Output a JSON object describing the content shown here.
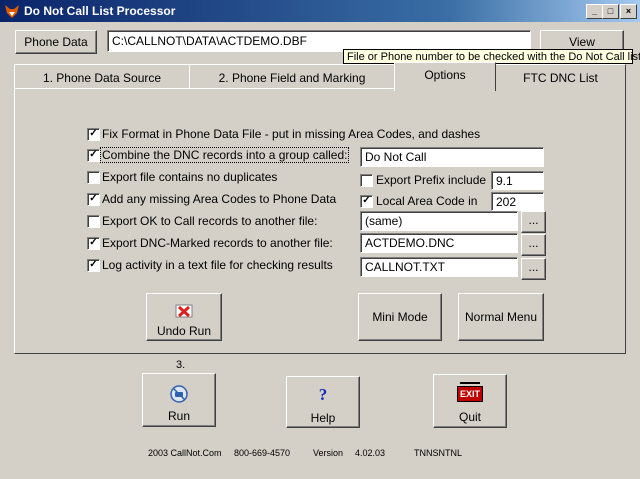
{
  "window": {
    "title": "Do Not Call List Processor",
    "controls": {
      "minimize": "_",
      "maximize": "□",
      "close": "×"
    }
  },
  "toolbar": {
    "phone_data_button": "Phone Data",
    "path_value": "C:\\CALLNOT\\DATA\\ACTDEMO.DBF",
    "view_button": "View",
    "tooltip": "File or Phone number to be checked with the Do Not Call list"
  },
  "tabs": [
    {
      "label": "1. Phone Data Source"
    },
    {
      "label": "2. Phone Field and Marking"
    },
    {
      "label": "Options",
      "active": true
    },
    {
      "label": "FTC DNC List"
    }
  ],
  "options": {
    "fix_format": {
      "label": "Fix Format in Phone Data File - put in missing Area Codes, and dashes",
      "checked": true
    },
    "combine_dnc": {
      "label": "Combine the DNC records into a group called:",
      "checked": true,
      "value": "Do Not Call"
    },
    "export_no_dupes": {
      "label": "Export file contains no duplicates",
      "checked": false
    },
    "export_prefix": {
      "label": "Export  Prefix include",
      "checked": false,
      "value": "9.1"
    },
    "add_area_codes": {
      "label": "Add any missing Area Codes to Phone Data",
      "checked": true
    },
    "local_area_code": {
      "label": "Local Area Code in",
      "checked": true,
      "value": "202"
    },
    "export_ok": {
      "label": "Export OK to Call records to another file:",
      "checked": false,
      "value": "(same)"
    },
    "export_dnc": {
      "label": "Export DNC-Marked records to another file:",
      "checked": true,
      "value": "ACTDEMO.DNC"
    },
    "log_activity": {
      "label": "Log activity in a text file for checking results",
      "checked": true,
      "value": "CALLNOT.TXT"
    },
    "browse_label": "..."
  },
  "buttons": {
    "undo_run": "Undo Run",
    "mini_mode": "Mini Mode",
    "normal_menu": "Normal Menu",
    "step_label": "3.",
    "run": "Run",
    "help": "Help",
    "quit": "Quit",
    "exit_sign": "EXIT",
    "help_glyph": "?"
  },
  "footer": {
    "copyright": "2003  CallNot.Com",
    "phone": "800-669-4570",
    "version_label": "Version",
    "version": "4.02.03",
    "code": "TNNSNTNL"
  },
  "colors": {
    "titlebar_start": "#0a246a",
    "titlebar_end": "#a6caf0",
    "face": "#d4d0c8",
    "tooltip_bg": "#ffffe1",
    "undo_icon_red": "#e02020",
    "exit_red": "#c00000"
  },
  "icons": {
    "app": "fox-head-icon",
    "undo": "red-x-icon",
    "run": "no-phone-icon",
    "help": "question-mark-icon",
    "quit": "exit-sign-icon"
  }
}
